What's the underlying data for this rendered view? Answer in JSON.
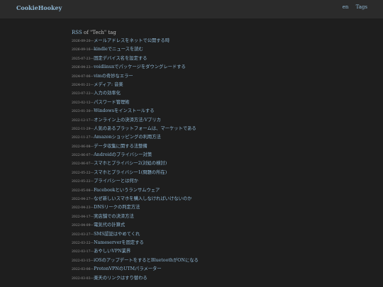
{
  "header": {
    "brand": "CookieHookey",
    "nav": [
      "en",
      "Tags"
    ]
  },
  "page": {
    "rss_label": "RSS",
    "heading_rest": " of \"Tech\" tag"
  },
  "posts": [
    {
      "date": "2026-09-20",
      "title": "メールアドレスをネットで公開する時"
    },
    {
      "date": "2026-09-16",
      "title": "kindleでニュースを読む"
    },
    {
      "date": "2025-07-23",
      "title": "固定デバイス名を設定する"
    },
    {
      "date": "2026-04-23",
      "title": "voidlinuxでパッケージをダウングレードする"
    },
    {
      "date": "2024-07-06",
      "title": "vimの奇妙なエラー"
    },
    {
      "date": "2024-01-21",
      "title": "メディア: 音楽"
    },
    {
      "date": "2023-07-22",
      "title": "入力の効率化"
    },
    {
      "date": "2023-02-12",
      "title": "パスワード管理術"
    },
    {
      "date": "2023-01-30",
      "title": "Windowsをインストールする"
    },
    {
      "date": "2022-12-17",
      "title": "オンライン上の決済方法:Vプリカ"
    },
    {
      "date": "2022-11-29",
      "title": "人気のあるプラットフォームは、マーケットである"
    },
    {
      "date": "2022-11-27",
      "title": "Amazonショッピングの利用方法"
    },
    {
      "date": "2022-06-08",
      "title": "データ収集に関する法整備"
    },
    {
      "date": "2022-06-07",
      "title": "Androidのプライバシー対策"
    },
    {
      "date": "2022-06-07",
      "title": "スマホとプライバシー2(対処の検討)"
    },
    {
      "date": "2022-05-22",
      "title": "スマホとプライバシー1(問題の所在)"
    },
    {
      "date": "2022-05-22",
      "title": "プライバシーとは何か"
    },
    {
      "date": "2022-05-08",
      "title": "Facebookというランサムウェア"
    },
    {
      "date": "2022-04-27",
      "title": "なぜ新しいスマホを購入しなければいけないのか"
    },
    {
      "date": "2022-04-23",
      "title": "DNSリークの判定方法"
    },
    {
      "date": "2022-04-17",
      "title": "実店舗での決済方法"
    },
    {
      "date": "2022-04-09",
      "title": "電気代の計算式"
    },
    {
      "date": "2022-03-27",
      "title": "SMS認証はやめてくれ"
    },
    {
      "date": "2022-03-22",
      "title": "Nameserverを固定する"
    },
    {
      "date": "2022-03-17",
      "title": "あやしいVPN業界"
    },
    {
      "date": "2022-03-15",
      "title": "iOSのアップデートをするとBluetoothがONになる"
    },
    {
      "date": "2022-03-06",
      "title": "ProtonVPNのUTMパラメーター"
    },
    {
      "date": "2022-03-03",
      "title": "楽天のリンクはすり替わる"
    }
  ],
  "colors": {
    "background": "#1e1e1e",
    "header": "#2b2b2b",
    "link": "#8fb7d4",
    "date": "#9a9a9a"
  }
}
